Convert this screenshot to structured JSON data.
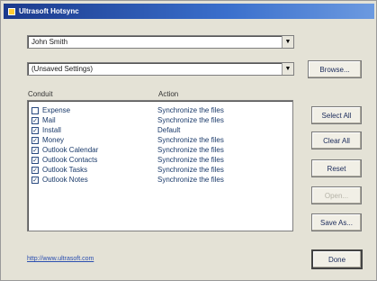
{
  "window": {
    "title": "Ultrasoft Hotsync"
  },
  "combos": {
    "user": {
      "value": "John Smith"
    },
    "settings": {
      "value": "(Unsaved Settings)"
    }
  },
  "buttons": {
    "browse": "Browse...",
    "select_all": "Select All",
    "clear_all": "Clear All",
    "reset": "Reset",
    "open": "Open...",
    "save_as": "Save As...",
    "done": "Done"
  },
  "list": {
    "headers": {
      "conduit": "Conduit",
      "action": "Action"
    },
    "rows": [
      {
        "conduit": "Expense",
        "action": "Synchronize the files",
        "checked": false
      },
      {
        "conduit": "Mail",
        "action": "Synchronize the files",
        "checked": true
      },
      {
        "conduit": "Install",
        "action": "Default",
        "checked": true
      },
      {
        "conduit": "Money",
        "action": "Synchronize the files",
        "checked": true
      },
      {
        "conduit": "Outlook Calendar",
        "action": "Synchronize the files",
        "checked": true
      },
      {
        "conduit": "Outlook Contacts",
        "action": "Synchronize the files",
        "checked": true
      },
      {
        "conduit": "Outlook Tasks",
        "action": "Synchronize the files",
        "checked": true
      },
      {
        "conduit": "Outlook Notes",
        "action": "Synchronize the files",
        "checked": true
      }
    ]
  },
  "footer": {
    "link": "http://www.ultrasoft.com"
  },
  "glyphs": {
    "arrow": "▼",
    "check": "✓"
  }
}
